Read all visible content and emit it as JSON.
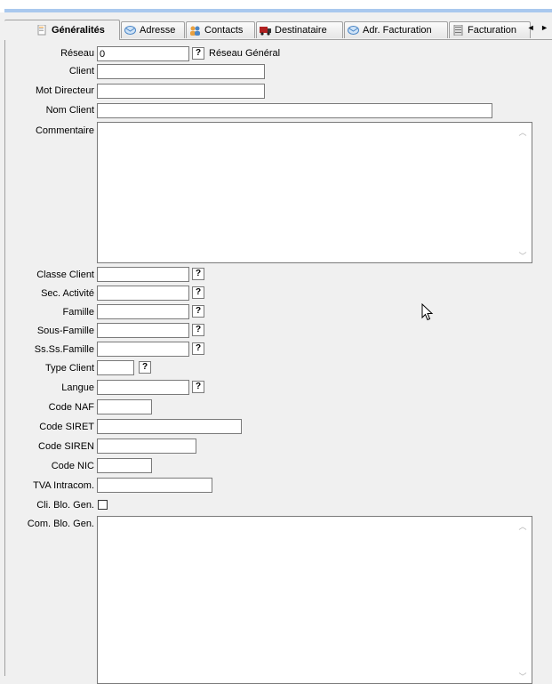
{
  "tabs": [
    {
      "label": "Généralités",
      "icon": "document-icon",
      "active": true
    },
    {
      "label": "Adresse",
      "icon": "envelope-icon",
      "active": false
    },
    {
      "label": "Contacts",
      "icon": "people-icon",
      "active": false
    },
    {
      "label": "Destinataire",
      "icon": "truck-icon",
      "active": false
    },
    {
      "label": "Adr. Facturation",
      "icon": "envelope-icon",
      "active": false
    },
    {
      "label": "Facturation",
      "icon": "invoice-icon",
      "active": false
    }
  ],
  "tab_scroll": "◄ ►",
  "form": {
    "reseau": {
      "label": "Réseau",
      "value": "0",
      "help": "?",
      "description": "Réseau Général"
    },
    "client": {
      "label": "Client",
      "value": ""
    },
    "mot_directeur": {
      "label": "Mot Directeur",
      "value": ""
    },
    "nom_client": {
      "label": "Nom Client",
      "value": ""
    },
    "commentaire": {
      "label": "Commentaire",
      "value": ""
    },
    "classe_client": {
      "label": "Classe Client",
      "value": "",
      "help": "?"
    },
    "sec_activite": {
      "label": "Sec. Activité",
      "value": "",
      "help": "?"
    },
    "famille": {
      "label": "Famille",
      "value": "",
      "help": "?"
    },
    "sous_famille": {
      "label": "Sous-Famille",
      "value": "",
      "help": "?"
    },
    "ss_ss_famille": {
      "label": "Ss.Ss.Famille",
      "value": "",
      "help": "?"
    },
    "type_client": {
      "label": "Type Client",
      "value": "",
      "help": "?"
    },
    "langue": {
      "label": "Langue",
      "value": "",
      "help": "?"
    },
    "code_naf": {
      "label": "Code NAF",
      "value": ""
    },
    "code_siret": {
      "label": "Code SIRET",
      "value": ""
    },
    "code_siren": {
      "label": "Code SIREN",
      "value": ""
    },
    "code_nic": {
      "label": "Code NIC",
      "value": ""
    },
    "tva_intracom": {
      "label": "TVA Intracom.",
      "value": ""
    },
    "cli_blo_gen": {
      "label": "Cli. Blo. Gen.",
      "checked": false
    },
    "com_blo_gen": {
      "label": "Com. Blo. Gen.",
      "value": ""
    }
  }
}
